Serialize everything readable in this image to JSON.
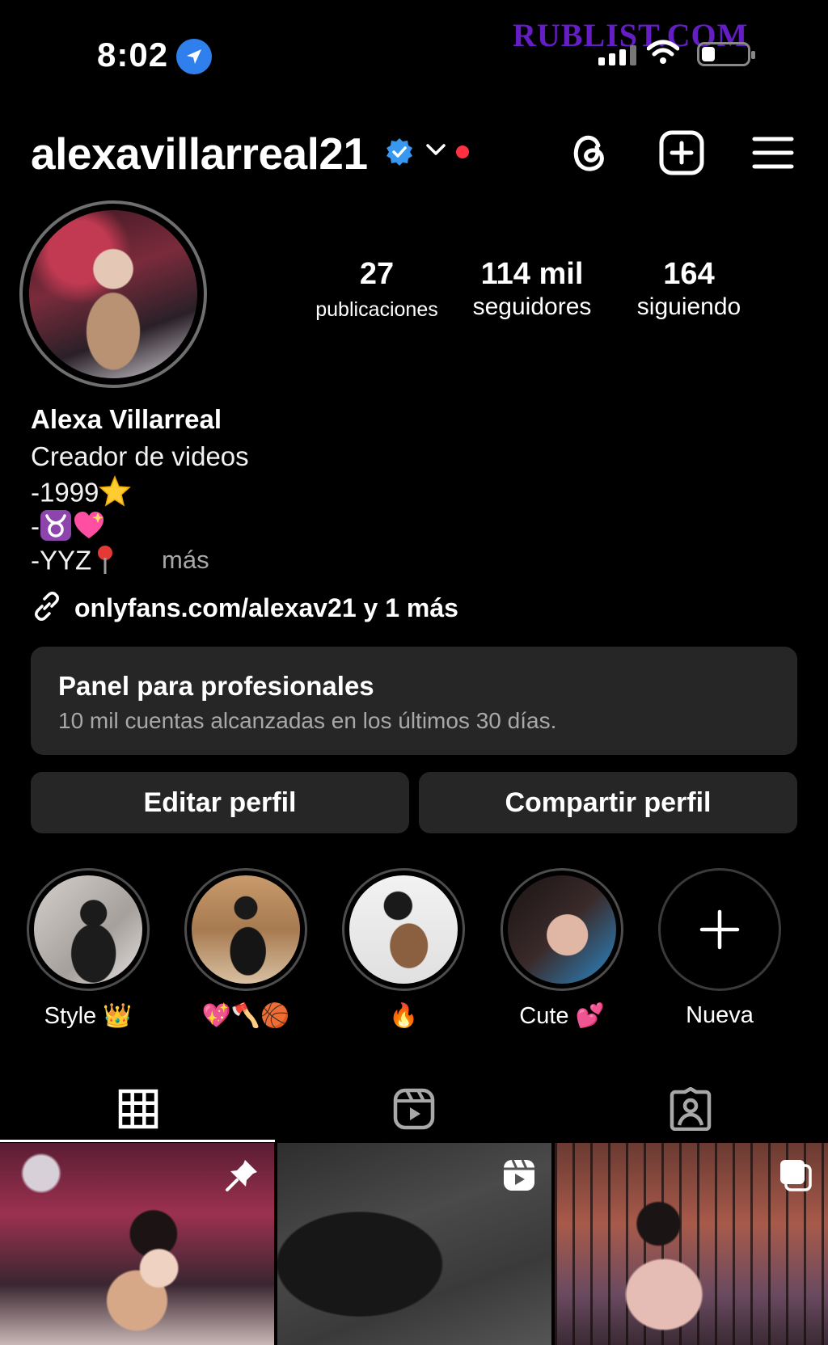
{
  "status_bar": {
    "time": "8:02",
    "watermark": "RUBLIST.COM"
  },
  "profile": {
    "username": "alexavillarreal21",
    "full_name": "Alexa Villarreal",
    "category": "Creador de videos",
    "bio_lines": [
      "-1999",
      "-",
      "-YYZ"
    ],
    "more_label": "más",
    "link_text": "onlyfans.com/alexav21 y 1 más"
  },
  "stats": [
    {
      "value": "27",
      "label": "publicaciones"
    },
    {
      "value": "114 mil",
      "label": "seguidores"
    },
    {
      "value": "164",
      "label": "siguiendo"
    }
  ],
  "panel": {
    "title": "Panel para profesionales",
    "subtitle": "10 mil cuentas alcanzadas en los últimos 30 días."
  },
  "buttons": {
    "edit": "Editar perfil",
    "share": "Compartir perfil"
  },
  "highlights": [
    {
      "label": "Style 👑"
    },
    {
      "label": "💖🪓🏀"
    },
    {
      "label": "🔥"
    },
    {
      "label": "Cute 💕"
    },
    {
      "label": "Nueva"
    }
  ],
  "colors": {
    "accent_verified": "#3897f0",
    "notification_dot": "#ff3040",
    "panel_bg": "#262626"
  }
}
